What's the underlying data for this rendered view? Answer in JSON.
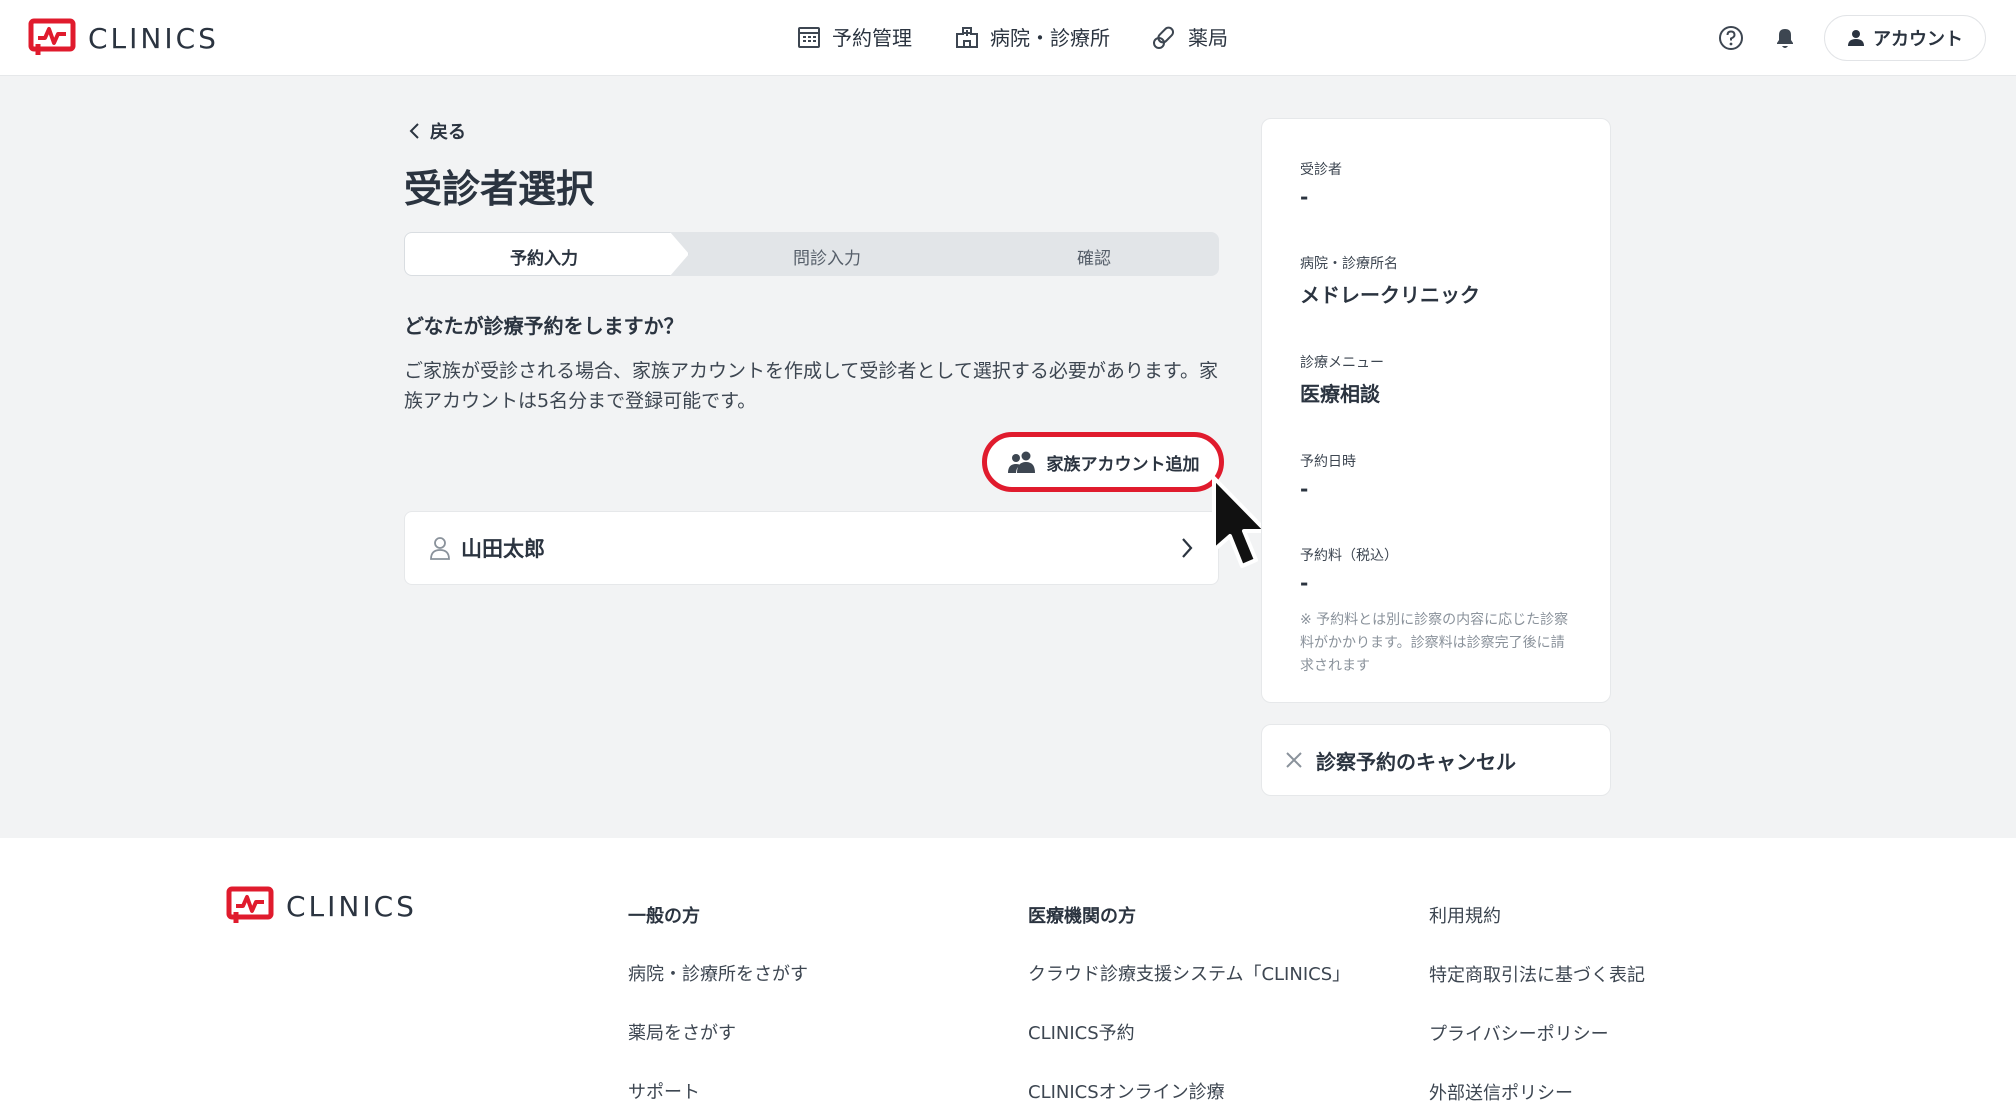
{
  "header": {
    "logo_text": "CLINICS",
    "nav": [
      {
        "label": "予約管理",
        "icon": "calendar-icon"
      },
      {
        "label": "病院・診療所",
        "icon": "hospital-icon"
      },
      {
        "label": "薬局",
        "icon": "pill-icon"
      }
    ],
    "account_label": "アカウント"
  },
  "main": {
    "back_label": "戻る",
    "title": "受診者選択",
    "steps": [
      "予約入力",
      "問診入力",
      "確認"
    ],
    "question": "どなたが診療予約をしますか？",
    "description": "ご家族が受診される場合、家族アカウントを作成して受診者として選択する必要があります。家族アカウントは5名分まで登録可能です。",
    "add_family_label": "家族アカウント追加",
    "patient_name": "山田太郎"
  },
  "summary": {
    "patient_label": "受診者",
    "patient_value": "-",
    "clinic_label": "病院・診療所名",
    "clinic_value": "メドレークリニック",
    "menu_label": "診療メニュー",
    "menu_value": "医療相談",
    "datetime_label": "予約日時",
    "datetime_value": "-",
    "fee_label": "予約料（税込）",
    "fee_value": "-",
    "fee_note": "※ 予約料とは別に診察の内容に応じた診察料がかかります。診察料は診察完了後に請求されます",
    "cancel_label": "診察予約のキャンセル"
  },
  "footer": {
    "logo_text": "CLINICS",
    "col1": {
      "heading": "一般の方",
      "links": [
        "病院・診療所をさがす",
        "薬局をさがす",
        "サポート"
      ]
    },
    "col2": {
      "heading": "医療機関の方",
      "links": [
        "クラウド診療支援システム「CLINICS」",
        "CLINICS予約",
        "CLINICSオンライン診療"
      ]
    },
    "col3": {
      "links": [
        "利用規約",
        "特定商取引法に基づく表記",
        "プライバシーポリシー",
        "外部送信ポリシー"
      ]
    }
  },
  "colors": {
    "accent": "#e01b2d",
    "text": "#2b3440",
    "background": "#f2f3f4"
  }
}
